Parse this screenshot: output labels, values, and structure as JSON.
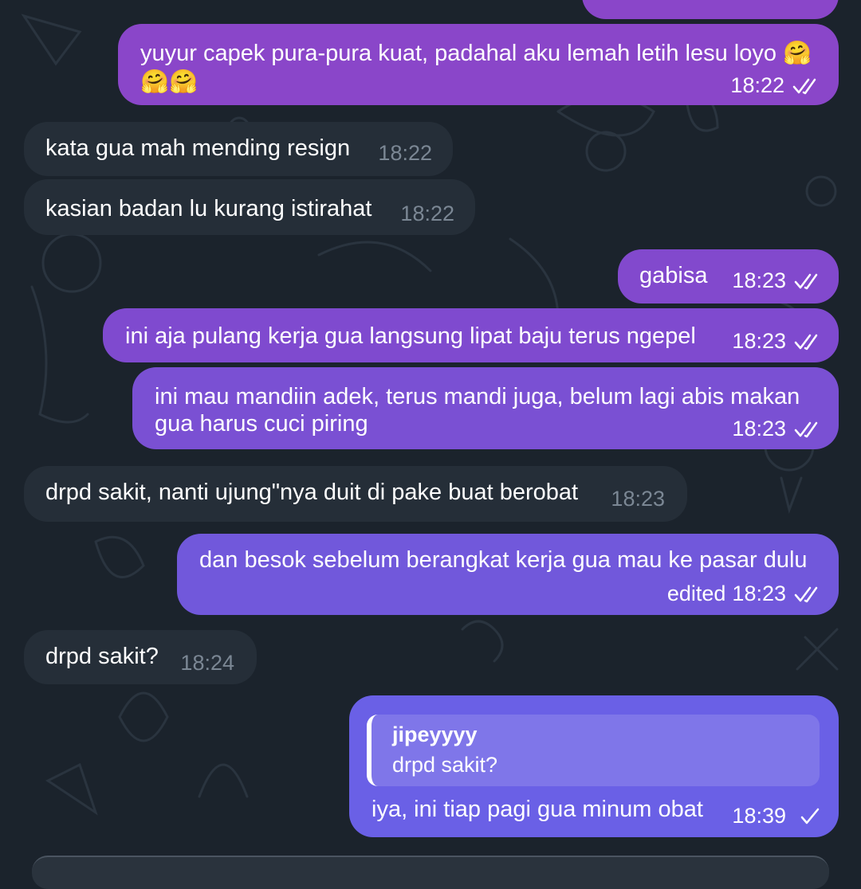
{
  "messages": [
    {
      "dir": "out",
      "text_lines": [
        "yuyur capek pura-pura kuat, padahal aku lemah letih lesu loyo 🤗",
        "🤗🤗"
      ],
      "time": "18:22",
      "status": "read"
    },
    {
      "dir": "in",
      "text": "kata gua mah mending resign",
      "time": "18:22"
    },
    {
      "dir": "in",
      "text": "kasian badan lu kurang istirahat",
      "time": "18:22"
    },
    {
      "dir": "out",
      "text": "gabisa",
      "time": "18:23",
      "status": "read"
    },
    {
      "dir": "out",
      "text": "ini aja pulang kerja gua langsung lipat baju terus ngepel",
      "time": "18:23",
      "status": "read"
    },
    {
      "dir": "out",
      "text_lines": [
        "ini mau mandiin adek, terus mandi juga, belum lagi abis makan",
        "gua harus cuci piring"
      ],
      "time": "18:23",
      "status": "read"
    },
    {
      "dir": "in",
      "text": "drpd sakit, nanti ujung\"nya duit di pake buat berobat",
      "time": "18:23"
    },
    {
      "dir": "out",
      "text": "dan besok sebelum berangkat kerja gua mau ke pasar dulu",
      "edited_label": "edited",
      "time": "18:23",
      "status": "read"
    },
    {
      "dir": "in",
      "text": "drpd sakit?",
      "time": "18:24"
    },
    {
      "dir": "out",
      "reply_to": {
        "name": "jipeyyyy",
        "text": "drpd sakit?"
      },
      "text": "iya, ini tiap pagi gua minum obat",
      "time": "18:39",
      "status": "sent"
    }
  ],
  "colors": {
    "background": "#1b232c",
    "incoming_bubble": "#252e38",
    "outgoing_gradient_top": "#8e47c8",
    "outgoing_gradient_bottom": "#6a5de8",
    "incoming_time": "#7b8794"
  },
  "icons": {
    "read": "double-check-icon",
    "sent": "single-check-icon"
  }
}
